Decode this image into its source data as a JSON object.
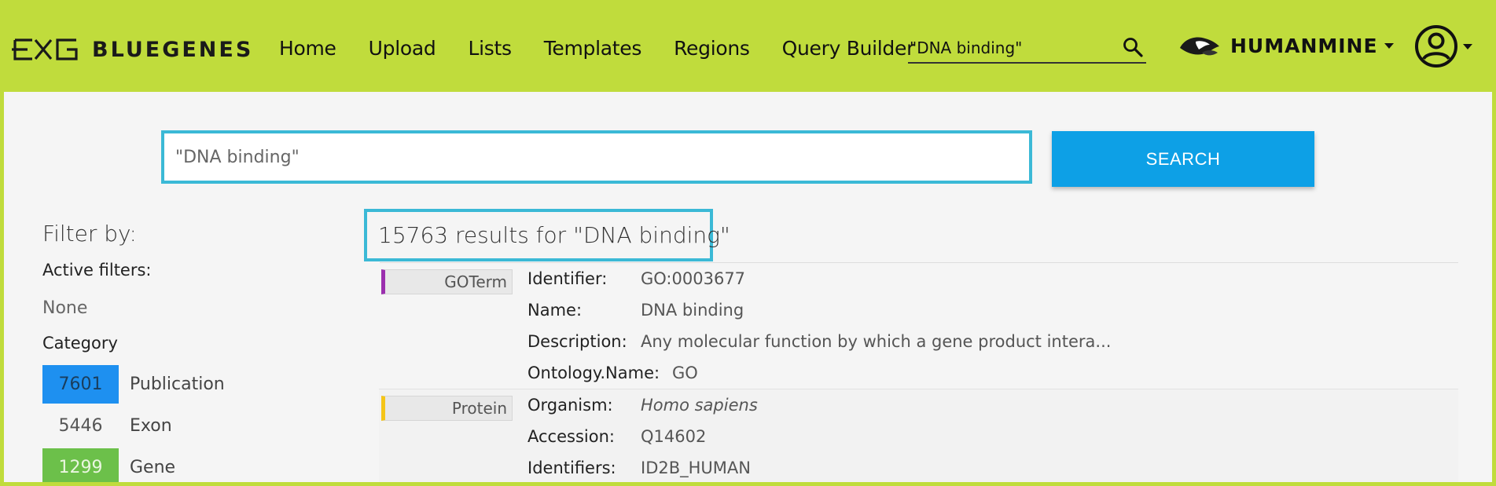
{
  "navbar": {
    "brand": "BLUEGENES",
    "links": [
      "Home",
      "Upload",
      "Lists",
      "Templates",
      "Regions",
      "Query Builder"
    ],
    "search_value": "\"DNA binding\"",
    "mine_label": "HUMANMINE",
    "colors": {
      "navbar_bg": "#c0dc3c"
    }
  },
  "search": {
    "value": "\"DNA binding\"",
    "button_label": "SEARCH",
    "button_color": "#0da0e6"
  },
  "sidebar": {
    "filter_title": "Filter by:",
    "active_filters_title": "Active filters:",
    "active_filters_value": "None",
    "category_title": "Category",
    "categories": [
      {
        "count": "7601",
        "label": "Publication",
        "color": "#1e90f0"
      },
      {
        "count": "5446",
        "label": "Exon",
        "color": ""
      },
      {
        "count": "1299",
        "label": "Gene",
        "color": "#6cc04a"
      }
    ]
  },
  "results": {
    "header": "15763 results for \"DNA binding\"",
    "items": [
      {
        "type": "GOTerm",
        "type_color": "#9b2fae",
        "fields": [
          {
            "name": "Identifier:",
            "value": "GO:0003677"
          },
          {
            "name": "Name:",
            "value": "DNA binding"
          },
          {
            "name": "Description:",
            "value": "Any molecular function by which a gene product intera..."
          },
          {
            "name": "Ontology.Name:",
            "value": "GO"
          }
        ]
      },
      {
        "type": "Protein",
        "type_color": "#f5c518",
        "fields": [
          {
            "name": "Organism:",
            "value": "Homo sapiens"
          },
          {
            "name": "Accession:",
            "value": "Q14602"
          },
          {
            "name": "Identifiers:",
            "value": "ID2B_HUMAN"
          }
        ]
      }
    ]
  }
}
